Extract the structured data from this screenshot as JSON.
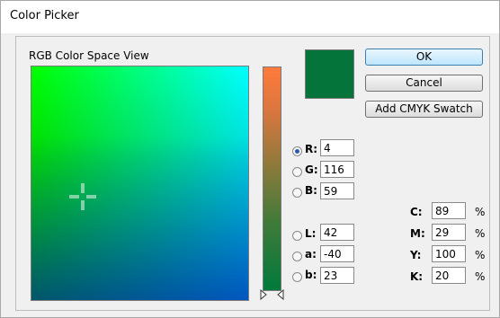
{
  "window": {
    "title": "Color Picker"
  },
  "section_label": "RGB Color Space View",
  "current_color": "#04743b",
  "buttons": {
    "ok": "OK",
    "cancel": "Cancel",
    "add_cmyk": "Add CMYK Swatch"
  },
  "rgb": [
    {
      "label": "R:",
      "value": "4",
      "selected": true
    },
    {
      "label": "G:",
      "value": "116",
      "selected": false
    },
    {
      "label": "B:",
      "value": "59",
      "selected": false
    }
  ],
  "lab": [
    {
      "label": "L:",
      "value": "42",
      "selected": false
    },
    {
      "label": "a:",
      "value": "-40",
      "selected": false
    },
    {
      "label": "b:",
      "value": "23",
      "selected": false
    }
  ],
  "cmyk": [
    {
      "label": "C:",
      "value": "89",
      "unit": "%"
    },
    {
      "label": "M:",
      "value": "29",
      "unit": "%"
    },
    {
      "label": "Y:",
      "value": "100",
      "unit": "%"
    },
    {
      "label": "K:",
      "value": "20",
      "unit": "%"
    }
  ],
  "colors": {
    "ok_border": "#3c7fb1",
    "radio_dot": "#2a5aa8"
  }
}
